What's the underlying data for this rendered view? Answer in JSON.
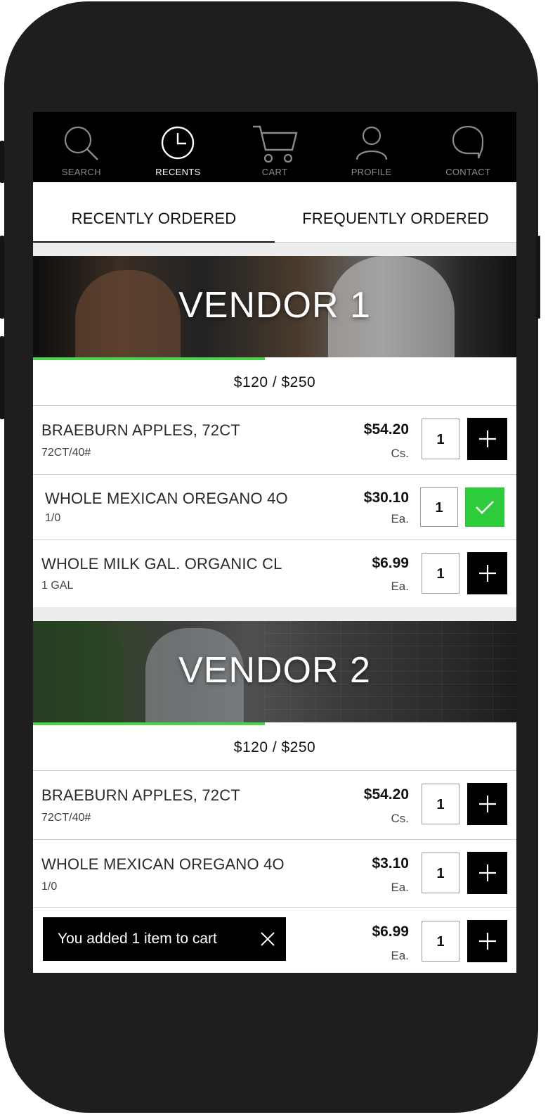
{
  "nav": [
    {
      "label": "SEARCH",
      "icon": "search-icon",
      "active": false
    },
    {
      "label": "RECENTS",
      "icon": "clock-icon",
      "active": true
    },
    {
      "label": "CART",
      "icon": "cart-icon",
      "active": false
    },
    {
      "label": "PROFILE",
      "icon": "profile-icon",
      "active": false
    },
    {
      "label": "CONTACT",
      "icon": "chat-icon",
      "active": false
    }
  ],
  "tabs": {
    "recent": "RECENTLY ORDERED",
    "frequent": "FREQUENTLY ORDERED"
  },
  "vendors": [
    {
      "name": "VENDOR 1",
      "total": "$120 / $250",
      "progress": 0.48,
      "items": [
        {
          "name": "BRAEBURN APPLES, 72CT",
          "sub": "72CT/40#",
          "price": "$54.20",
          "unit": "Cs.",
          "qty": "1",
          "added": false
        },
        {
          "name": "WHOLE MEXICAN OREGANO 4O",
          "sub": "1/0",
          "price": "$30.10",
          "unit": "Ea.",
          "qty": "1",
          "added": true
        },
        {
          "name": "WHOLE MILK GAL. ORGANIC CL",
          "sub": "1 GAL",
          "price": "$6.99",
          "unit": "Ea.",
          "qty": "1",
          "added": false
        }
      ]
    },
    {
      "name": "VENDOR 2",
      "total": "$120 / $250",
      "progress": 0.48,
      "items": [
        {
          "name": "BRAEBURN APPLES, 72CT",
          "sub": "72CT/40#",
          "price": "$54.20",
          "unit": "Cs.",
          "qty": "1",
          "added": false
        },
        {
          "name": "WHOLE MEXICAN OREGANO 4O",
          "sub": "1/0",
          "price": "$3.10",
          "unit": "Ea.",
          "qty": "1",
          "added": false
        },
        {
          "name": "",
          "sub": "",
          "price": "$6.99",
          "unit": "Ea.",
          "qty": "1",
          "added": false
        }
      ]
    }
  ],
  "toast": {
    "message": "You added 1 item to cart"
  },
  "colors": {
    "accent_green": "#2ccc3a",
    "progress_green": "#4ad44a",
    "nav_bg": "#000000"
  }
}
